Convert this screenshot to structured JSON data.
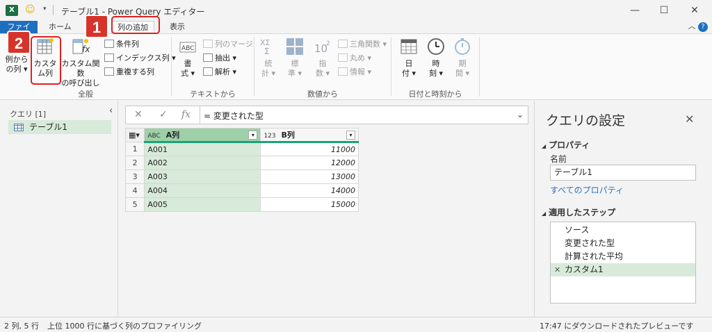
{
  "window": {
    "title": "テーブル1 - Power Query エディター",
    "app_icon": "excel-icon",
    "controls": {
      "minimize": "—",
      "maximize": "☐",
      "close": "✕"
    }
  },
  "tabs": [
    "ファイル",
    "ホーム",
    "列の追加",
    "表示"
  ],
  "active_tab": "列の追加",
  "ribbon": {
    "groups": {
      "general": {
        "label": "全般",
        "col_from_examples": [
          "例から",
          "の列 ▾"
        ],
        "custom_column": [
          "カスタ",
          "ム列"
        ],
        "custom_function": [
          "カスタム関数",
          "の呼び出し"
        ],
        "conditional": "条件列",
        "index": "インデックス列 ▾",
        "duplicate": "重複する列"
      },
      "text": {
        "label": "テキストから",
        "format": [
          "書",
          "式 ▾"
        ],
        "merge": "列のマージ",
        "extract": "抽出 ▾",
        "parse": "解析 ▾"
      },
      "number": {
        "label": "数値から",
        "statistics": [
          "統",
          "計 ▾"
        ],
        "standard": [
          "標",
          "準 ▾"
        ],
        "scientific": [
          "指",
          "数 ▾"
        ],
        "trig": "三角関数 ▾",
        "rounding": "丸め ▾",
        "info": "情報 ▾"
      },
      "datetime": {
        "label": "日付と時刻から",
        "date": [
          "日",
          "付 ▾"
        ],
        "time": [
          "時",
          "刻 ▾"
        ],
        "duration": [
          "期",
          "間 ▾"
        ]
      }
    }
  },
  "callouts": {
    "one": "1",
    "two": "2"
  },
  "queries": {
    "header": "クエリ [1]",
    "items": [
      "テーブル1"
    ]
  },
  "formula_bar": {
    "cancel": "✕",
    "commit": "✓",
    "fx": "fx",
    "text": "= 変更された型"
  },
  "grid": {
    "columns": [
      {
        "type_icon": "ABC",
        "name": "A列"
      },
      {
        "type_icon": "123",
        "name": "B列"
      }
    ],
    "rows": [
      {
        "n": "1",
        "a": "A001",
        "b": "11000"
      },
      {
        "n": "2",
        "a": "A002",
        "b": "12000"
      },
      {
        "n": "3",
        "a": "A003",
        "b": "13000"
      },
      {
        "n": "4",
        "a": "A004",
        "b": "14000"
      },
      {
        "n": "5",
        "a": "A005",
        "b": "15000"
      }
    ]
  },
  "settings": {
    "title": "クエリの設定",
    "properties_header": "プロパティ",
    "name_label": "名前",
    "name_value": "テーブル1",
    "all_properties_link": "すべてのプロパティ",
    "steps_header": "適用したステップ",
    "steps": [
      "ソース",
      "変更された型",
      "計算された平均",
      "カスタム1"
    ],
    "selected_step": "カスタム1"
  },
  "status": {
    "left": "2 列, 5 行",
    "profiling": "上位 1000 行に基づく列のプロファイリング",
    "right": "17:47 にダウンロードされたプレビューです"
  }
}
